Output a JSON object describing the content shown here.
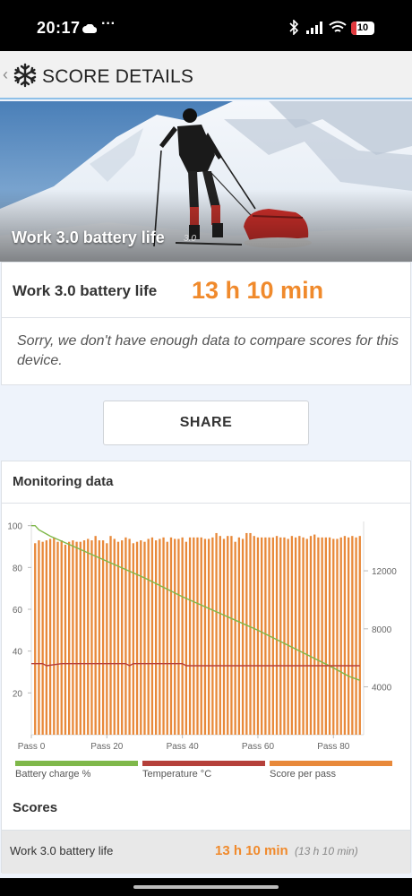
{
  "status_bar": {
    "time": "20:17",
    "more": "···",
    "battery_level": "10"
  },
  "header": {
    "title": "SCORE DETAILS"
  },
  "hero": {
    "caption": "Work 3.0 battery life",
    "version": "3.0"
  },
  "result": {
    "label": "Work 3.0 battery life",
    "value": "13 h 10 min",
    "note": "Sorry, we don't have enough data to compare scores for this device."
  },
  "share_label": "SHARE",
  "monitoring": {
    "title": "Monitoring data",
    "legend": [
      {
        "label": "Battery charge %",
        "color": "#7fb84a"
      },
      {
        "label": "Temperature °C",
        "color": "#b5403a"
      },
      {
        "label": "Score per pass",
        "color": "#e8893a"
      }
    ]
  },
  "chart_data": {
    "type": "bar",
    "x_tick_labels": [
      "Pass 0",
      "Pass 20",
      "Pass 40",
      "Pass 60",
      "Pass 80"
    ],
    "x_ticks": [
      0,
      20,
      40,
      60,
      80
    ],
    "xlim": [
      0,
      88
    ],
    "y_left_ticks": [
      "100",
      "80",
      "60",
      "40",
      "20"
    ],
    "y_left_range": [
      0,
      102
    ],
    "y_right_ticks": [
      "12000",
      "8000",
      "4000"
    ],
    "y_right_range": [
      700,
      15400
    ],
    "series": [
      {
        "name": "Score per pass",
        "axis": "right",
        "x": [
          1,
          2,
          3,
          4,
          5,
          6,
          7,
          8,
          9,
          10,
          11,
          12,
          13,
          14,
          15,
          16,
          17,
          18,
          19,
          20,
          21,
          22,
          23,
          24,
          25,
          26,
          27,
          28,
          29,
          30,
          31,
          32,
          33,
          34,
          35,
          36,
          37,
          38,
          39,
          40,
          41,
          42,
          43,
          44,
          45,
          46,
          47,
          48,
          49,
          50,
          51,
          52,
          53,
          54,
          55,
          56,
          57,
          58,
          59,
          60,
          61,
          62,
          63,
          64,
          65,
          66,
          67,
          68,
          69,
          70,
          71,
          72,
          73,
          74,
          75,
          76,
          77,
          78,
          79,
          80,
          81,
          82,
          83,
          84,
          85,
          86,
          87
        ],
        "values": [
          13900,
          14100,
          14000,
          14100,
          14200,
          14300,
          14000,
          14100,
          13800,
          14000,
          14100,
          14000,
          14000,
          14100,
          14200,
          14100,
          14400,
          14100,
          14100,
          13900,
          14400,
          14200,
          14000,
          14100,
          14300,
          14200,
          13900,
          14000,
          14100,
          14000,
          14200,
          14300,
          14100,
          14200,
          14300,
          14000,
          14300,
          14200,
          14200,
          14300,
          14000,
          14300,
          14300,
          14300,
          14300,
          14200,
          14200,
          14300,
          14600,
          14400,
          14200,
          14400,
          14400,
          14000,
          14300,
          14200,
          14600,
          14600,
          14400,
          14300,
          14300,
          14300,
          14300,
          14300,
          14400,
          14300,
          14300,
          14200,
          14400,
          14300,
          14400,
          14300,
          14200,
          14400,
          14500,
          14300,
          14300,
          14300,
          14300,
          14200,
          14200,
          14300,
          14400,
          14300,
          14400,
          14300,
          14400
        ]
      },
      {
        "name": "Battery charge %",
        "axis": "left",
        "x": [
          0,
          1,
          2,
          3,
          5,
          10,
          20,
          30,
          40,
          50,
          60,
          70,
          80,
          82,
          84,
          87
        ],
        "values": [
          100,
          100,
          98,
          97,
          95,
          91,
          83,
          75,
          66,
          58,
          50,
          41,
          32,
          30,
          28,
          26
        ]
      },
      {
        "name": "Temperature °C",
        "axis": "left",
        "x": [
          0,
          3,
          4,
          8,
          25,
          26,
          27,
          30,
          40,
          41,
          60,
          87
        ],
        "values": [
          34,
          34,
          33,
          34,
          34,
          33,
          34,
          34,
          34,
          33,
          33,
          33
        ]
      }
    ]
  },
  "scores": {
    "title": "Scores",
    "rows": [
      {
        "label": "Work 3.0 battery life",
        "value": "13 h 10 min",
        "sub": "(13 h 10 min)"
      }
    ]
  }
}
